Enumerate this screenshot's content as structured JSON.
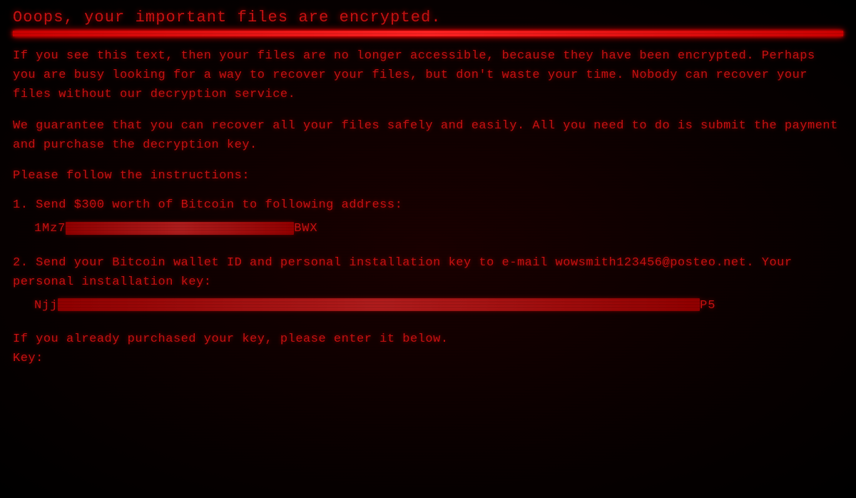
{
  "screen": {
    "title": "Ooops, your important files are encrypted.",
    "paragraph1": "If you see this text, then your files are no longer accessible, because they have been encrypted.  Perhaps you are busy looking for a way to recover your files, but don't waste your time.  Nobody can recover your files without our decryption service.",
    "paragraph2": "We guarantee that you can recover all your files safely and easily.  All you need to do is submit the payment and purchase the decryption key.",
    "instructions_header": "Please follow the instructions:",
    "step1_label": "1. Send $300 worth of Bitcoin to following address:",
    "btc_prefix": "1Mz7",
    "btc_suffix": "BWX",
    "step2_label": "2. Send your Bitcoin wallet ID and personal installation key to e-mail wowsmith123456@posteo.net. Your personal installation key:",
    "key_prefix": "Njj",
    "key_suffix": "P5",
    "footer_line": "If you already purchased your key, please enter it below.",
    "key_label": "Key:"
  }
}
